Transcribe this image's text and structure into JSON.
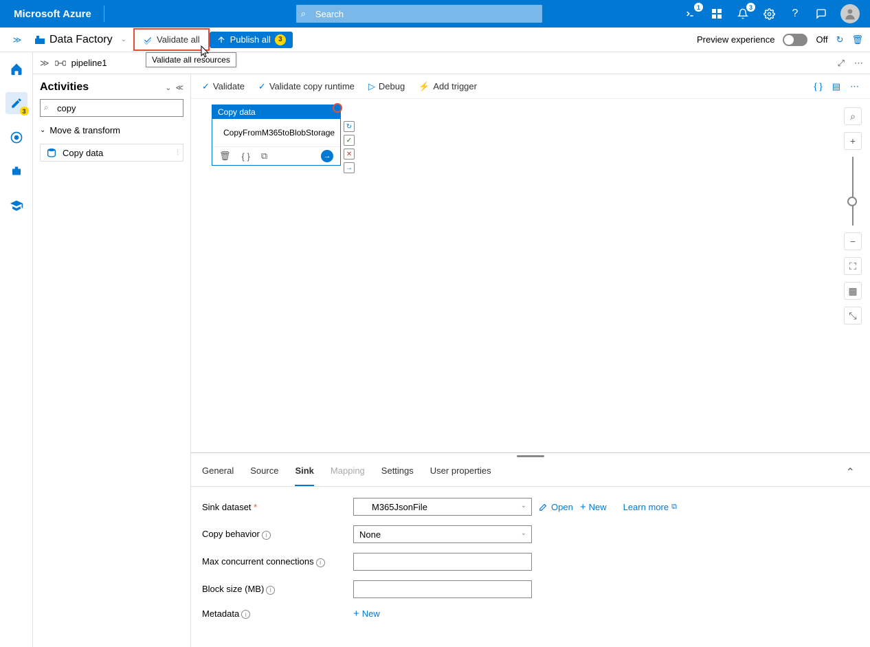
{
  "header": {
    "brand": "Microsoft Azure",
    "search_placeholder": "Search",
    "badge1": "1",
    "badge2": "3"
  },
  "toolbar": {
    "data_factory": "Data Factory",
    "validate_all": "Validate all",
    "publish_all": "Publish all",
    "publish_count": "3",
    "tooltip": "Validate all resources",
    "preview_label": "Preview experience",
    "toggle_off": "Off"
  },
  "rail": {
    "pencil_badge": "3"
  },
  "breadcrumb": {
    "pipeline": "pipeline1"
  },
  "activities": {
    "title": "Activities",
    "search_value": "copy",
    "group": "Move & transform",
    "item": "Copy data"
  },
  "canvas_toolbar": {
    "validate": "Validate",
    "validate_copy": "Validate copy runtime",
    "debug": "Debug",
    "add_trigger": "Add trigger"
  },
  "node": {
    "header": "Copy data",
    "label": "CopyFromM365toBlobStorage"
  },
  "tabs": {
    "general": "General",
    "source": "Source",
    "sink": "Sink",
    "mapping": "Mapping",
    "settings": "Settings",
    "user_props": "User properties"
  },
  "props": {
    "sink_dataset": "Sink dataset",
    "sink_value": "M365JsonFile",
    "open": "Open",
    "new": "New",
    "learn_more": "Learn more",
    "copy_behavior": "Copy behavior",
    "copy_behavior_value": "None",
    "max_conn": "Max concurrent connections",
    "block_size": "Block size (MB)",
    "metadata": "Metadata",
    "metadata_new": "New"
  }
}
